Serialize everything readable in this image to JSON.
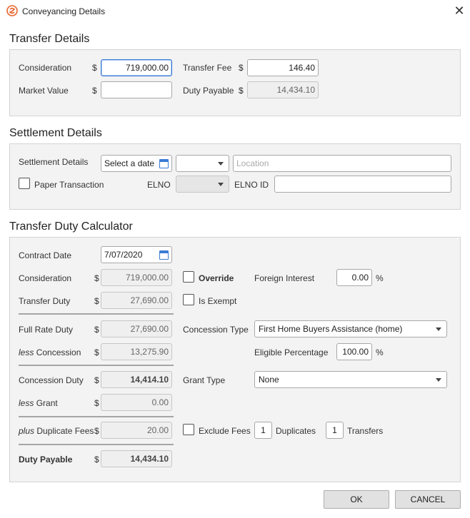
{
  "window": {
    "title": "Conveyancing Details",
    "close_glyph": "✕"
  },
  "transfer_details": {
    "heading": "Transfer Details",
    "consideration_label": "Consideration",
    "consideration_value": "719,000.00",
    "market_value_label": "Market Value",
    "market_value_value": "",
    "transfer_fee_label": "Transfer Fee",
    "transfer_fee_value": "146.40",
    "duty_payable_label": "Duty Payable",
    "duty_payable_value": "14,434.10",
    "currency": "$"
  },
  "settlement_details": {
    "heading": "Settlement Details",
    "settlement_label": "Settlement Details",
    "date_placeholder": "Select a date",
    "time_value": "",
    "location_placeholder": "Location",
    "paper_transaction_label": "Paper Transaction",
    "elno_label": "ELNO",
    "elno_value": "",
    "elno_id_label": "ELNO ID",
    "elno_id_value": ""
  },
  "calculator": {
    "heading": "Transfer Duty Calculator",
    "currency": "$",
    "contract_date_label": "Contract Date",
    "contract_date_value": "7/07/2020",
    "consideration_label": "Consideration",
    "consideration_value": "719,000.00",
    "transfer_duty_label": "Transfer Duty",
    "transfer_duty_value": "27,690.00",
    "full_rate_duty_label": "Full Rate Duty",
    "full_rate_duty_value": "27,690.00",
    "less_word": "less",
    "concession_label": "Concession",
    "concession_value": "13,275.90",
    "concession_duty_label": "Concession Duty",
    "concession_duty_value": "14,414.10",
    "grant_label": "Grant",
    "grant_value": "0.00",
    "plus_word": "plus",
    "duplicate_fees_label": "Duplicate Fees",
    "duplicate_fees_value": "20.00",
    "duty_payable_label": "Duty Payable",
    "duty_payable_value": "14,434.10",
    "override_label": "Override",
    "is_exempt_label": "Is Exempt",
    "foreign_interest_label": "Foreign Interest",
    "foreign_interest_value": "0.00",
    "percent": "%",
    "concession_type_label": "Concession Type",
    "concession_type_value": "First Home Buyers Assistance (home)",
    "eligible_percentage_label": "Eligible Percentage",
    "eligible_percentage_value": "100.00",
    "grant_type_label": "Grant Type",
    "grant_type_value": "None",
    "exclude_fees_label": "Exclude Fees",
    "duplicates_count": "1",
    "duplicates_label": "Duplicates",
    "transfers_count": "1",
    "transfers_label": "Transfers"
  },
  "buttons": {
    "ok": "OK",
    "cancel": "CANCEL"
  },
  "colors": {
    "accent": "#3a7bd5",
    "panel_bg": "#f3f3f3",
    "app_icon": "#e8642c"
  }
}
